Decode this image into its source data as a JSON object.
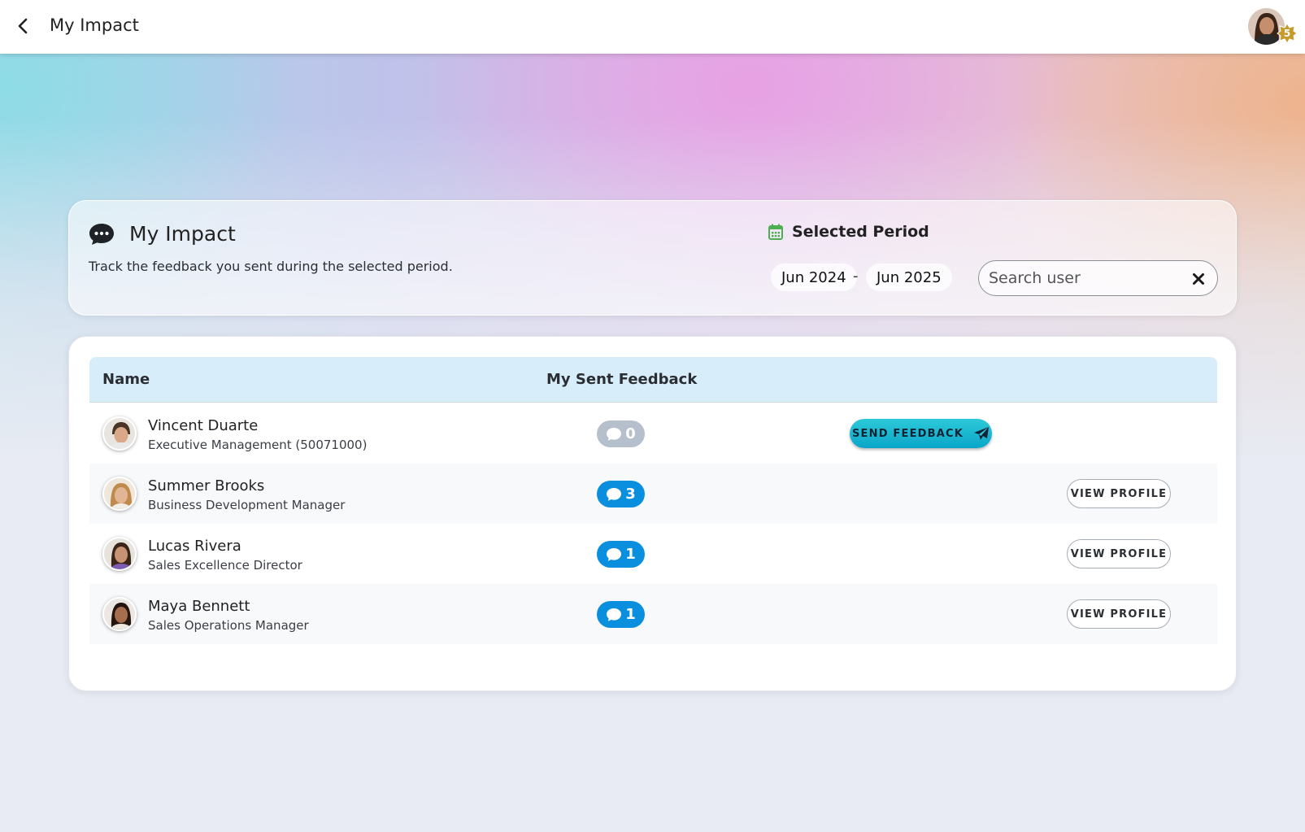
{
  "topbar": {
    "title": "My Impact",
    "user_level": "5",
    "icons": {
      "back": "chevron-left-icon",
      "avatar": "user-avatar",
      "level": "star-badge-icon"
    }
  },
  "header": {
    "title": "My Impact",
    "description": "Track the feedback you sent during the selected period.",
    "period_label": "Selected Period",
    "period_start": "Jun 2024",
    "period_separator": "-",
    "period_end": "Jun 2025",
    "search_placeholder": "Search user",
    "icons": {
      "title": "chat-bubble-icon",
      "period": "calendar-icon",
      "clear": "close-icon"
    }
  },
  "table": {
    "columns": [
      "Name",
      "My Sent Feedback"
    ],
    "rows": [
      {
        "name": "Vincent Duarte",
        "role": "Executive Management (50071000)",
        "sent_feedback": "0",
        "action": "SEND FEEDBACK"
      },
      {
        "name": "Summer Brooks",
        "role": "Business Development Manager",
        "sent_feedback": "3",
        "action": "VIEW PROFILE"
      },
      {
        "name": "Lucas Rivera",
        "role": "Sales Excellence Director",
        "sent_feedback": "1",
        "action": "VIEW PROFILE"
      },
      {
        "name": "Maya Bennett",
        "role": "Sales Operations Manager",
        "sent_feedback": "1",
        "action": "VIEW PROFILE"
      }
    ]
  },
  "colors": {
    "accent_blue": "#0a8fde",
    "zero_gray": "#b6c0cc",
    "send_button": "#0aa6c9",
    "table_header_bg": "#d8edfa",
    "calendar_green": "#4caf50",
    "level_badge_gold": "#c79a2a"
  }
}
